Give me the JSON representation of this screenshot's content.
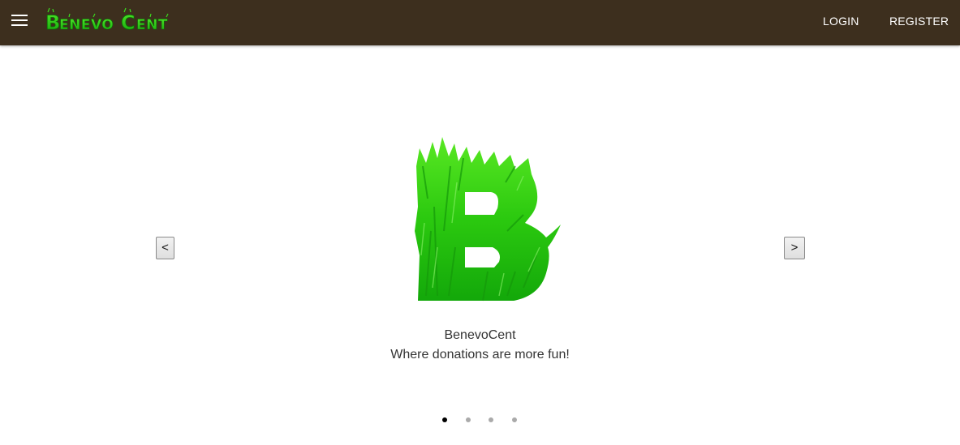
{
  "header": {
    "logo_text": "BenevoCent",
    "login_label": "LOGIN",
    "register_label": "REGISTER",
    "menu_icon": "hamburger-menu-icon",
    "background_color": "#3d2f1e",
    "logo_color": "#22cc11"
  },
  "carousel": {
    "prev_label": "<",
    "next_label": ">",
    "slide_title": "BenevoCent",
    "slide_subtitle": "Where donations are more fun!",
    "slide_image": "grass-letter-b-logo",
    "slide_count": 4,
    "active_index": 0
  }
}
